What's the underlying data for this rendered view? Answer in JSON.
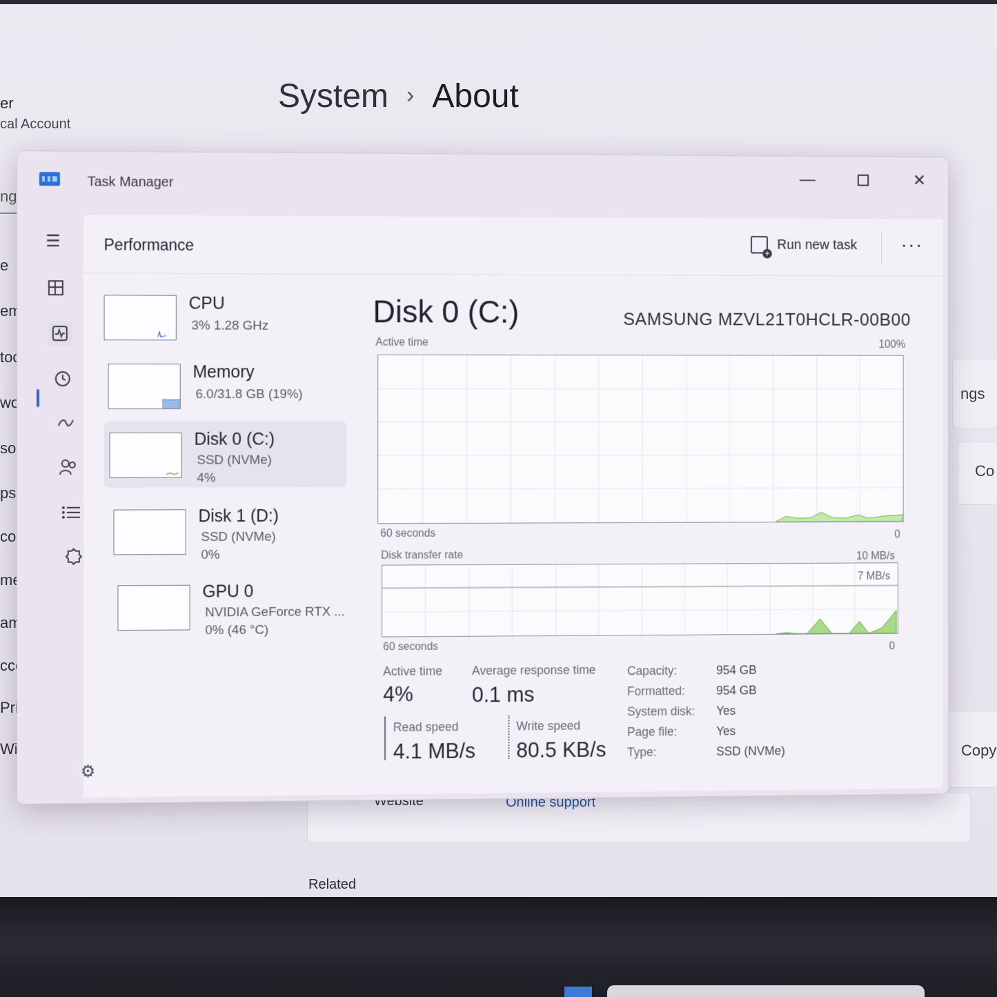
{
  "background": {
    "breadcrumb": {
      "section": "System",
      "separator": "›",
      "page": "About"
    },
    "user": {
      "name_fragment": "er",
      "account_fragment": "cal Account"
    },
    "search_fragment": "ng",
    "nav_fragments": [
      "e",
      "em",
      "toot",
      "work",
      "sonal",
      "ps",
      "count",
      "me & l",
      "aming",
      "ccessib",
      "Privacy &",
      "Window"
    ],
    "right_fragments": {
      "settings": "ngs",
      "copy_top": "Co",
      "copy": "Copy"
    },
    "website_label": "Website",
    "online_support": "Online support",
    "related": "Related"
  },
  "task_manager": {
    "title": "Task Manager",
    "header": {
      "title": "Performance",
      "run_new_task": "Run new task",
      "more": "···"
    },
    "devices": [
      {
        "name": "CPU",
        "line2": "3%  1.28 GHz",
        "line3": ""
      },
      {
        "name": "Memory",
        "line2": "6.0/31.8 GB (19%)",
        "line3": ""
      },
      {
        "name": "Disk 0 (C:)",
        "line2": "SSD (NVMe)",
        "line3": "4%"
      },
      {
        "name": "Disk 1 (D:)",
        "line2": "SSD (NVMe)",
        "line3": "0%"
      },
      {
        "name": "GPU 0",
        "line2": "NVIDIA GeForce RTX ...",
        "line3": "0%  (46 °C)"
      }
    ],
    "detail": {
      "title": "Disk 0 (C:)",
      "model": "SAMSUNG MZVL21T0HCLR-00B00",
      "graph1": {
        "label": "Active time",
        "max": "100%",
        "time": "60 seconds",
        "min": "0"
      },
      "graph2": {
        "label": "Disk transfer rate",
        "max": "10 MB/s",
        "inner": "7 MB/s",
        "time": "60 seconds",
        "min": "0"
      },
      "stats": {
        "active_time_label": "Active time",
        "active_time": "4%",
        "response_label": "Average response time",
        "response": "0.1 ms",
        "read_label": "Read speed",
        "read": "4.1 MB/s",
        "write_label": "Write speed",
        "write": "80.5 KB/s"
      },
      "properties": [
        {
          "k": "Capacity:",
          "v": "954 GB"
        },
        {
          "k": "Formatted:",
          "v": "954 GB"
        },
        {
          "k": "System disk:",
          "v": "Yes"
        },
        {
          "k": "Page file:",
          "v": "Yes"
        },
        {
          "k": "Type:",
          "v": "SSD (NVMe)"
        }
      ]
    }
  },
  "colors": {
    "accent": "#3a5fd0",
    "graph_fill": "#a9d98a",
    "graph_line": "#5aa53a",
    "window_bg": "#e9e4f0"
  }
}
